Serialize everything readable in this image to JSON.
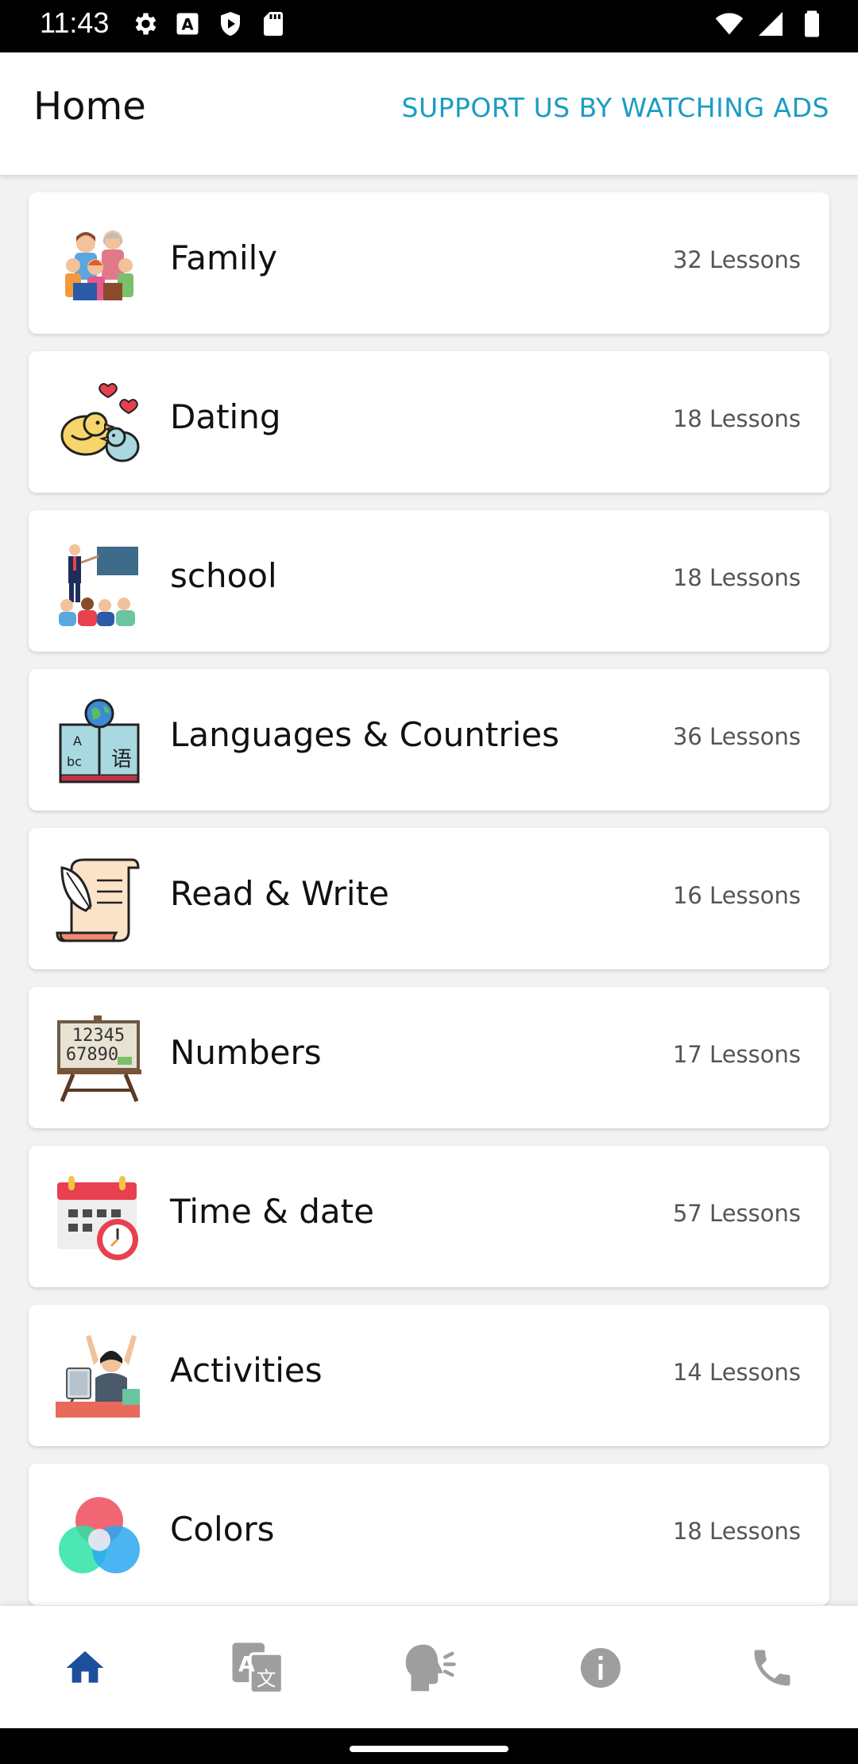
{
  "status_bar": {
    "time": "11:43",
    "left_icons": [
      "gear-icon",
      "a-notification-icon",
      "shield-icon",
      "sd-card-icon"
    ],
    "right_icons": [
      "wifi-icon",
      "signal-icon",
      "battery-icon"
    ]
  },
  "app_bar": {
    "title": "Home",
    "support_link": "SUPPORT US BY WATCHING ADS",
    "accent_color": "#1a9dc4"
  },
  "categories": [
    {
      "title": "Family",
      "count": "32 Lessons",
      "icon": "family-icon"
    },
    {
      "title": "Dating",
      "count": "18 Lessons",
      "icon": "love-birds-icon"
    },
    {
      "title": "school",
      "count": "18 Lessons",
      "icon": "classroom-icon"
    },
    {
      "title": "Languages & Countries",
      "count": "36 Lessons",
      "icon": "globe-book-icon"
    },
    {
      "title": "Read & Write",
      "count": "16 Lessons",
      "icon": "quill-scroll-icon"
    },
    {
      "title": "Numbers",
      "count": "17 Lessons",
      "icon": "number-board-icon"
    },
    {
      "title": "Time & date",
      "count": "57 Lessons",
      "icon": "calendar-clock-icon"
    },
    {
      "title": "Activities",
      "count": "14 Lessons",
      "icon": "person-computer-icon"
    },
    {
      "title": "Colors",
      "count": "18 Lessons",
      "icon": "color-circles-icon"
    }
  ],
  "bottom_nav": [
    {
      "name": "home",
      "icon": "home-icon",
      "active": true
    },
    {
      "name": "translate",
      "icon": "translate-icon",
      "active": false
    },
    {
      "name": "speak",
      "icon": "speaking-head-icon",
      "active": false
    },
    {
      "name": "info",
      "icon": "info-icon",
      "active": false
    },
    {
      "name": "contact",
      "icon": "phone-icon",
      "active": false
    }
  ],
  "colors": {
    "nav_active": "#1c4f9c",
    "nav_inactive": "#9e9e9e"
  }
}
